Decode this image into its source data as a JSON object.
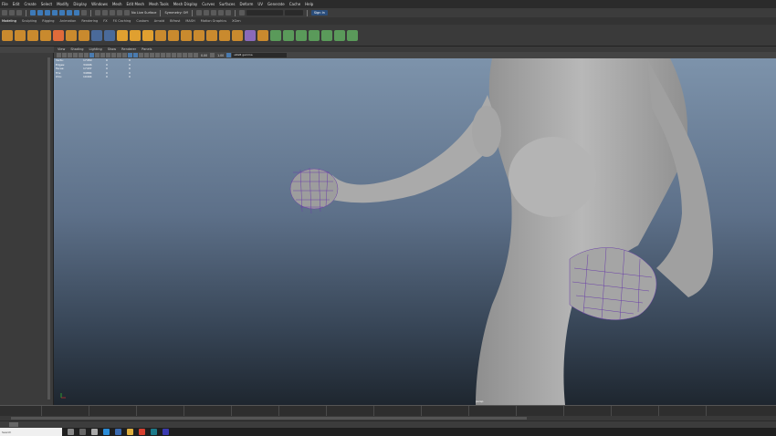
{
  "menus": [
    "File",
    "Edit",
    "Create",
    "Select",
    "Modify",
    "Display",
    "Windows",
    "Mesh",
    "Edit Mesh",
    "Mesh Tools",
    "Mesh Display",
    "Curves",
    "Surfaces",
    "Deform",
    "UV",
    "Generate",
    "Cache",
    "Help"
  ],
  "statusline": {
    "no_live_surface": "No Live Surface",
    "symmetry": "Symmetry: Off",
    "sign_in": "Sign In"
  },
  "shelf_tabs": [
    "Modeling",
    "Sculpting",
    "Rigging",
    "Animation",
    "Rendering",
    "FX",
    "FX Caching",
    "Custom",
    "Arnold",
    "Bifrost",
    "MASH",
    "Motion Graphics",
    "XGen"
  ],
  "shelf_tabs_active": "Modeling",
  "viewport_menu": [
    "View",
    "Shading",
    "Lighting",
    "Show",
    "Renderer",
    "Panels"
  ],
  "viewport_toolbar": {
    "exposure": "0.00",
    "gamma": "1.00",
    "color_space": "sRGB gamma"
  },
  "hud": [
    {
      "label": "Verts:",
      "a": "17450",
      "b": "0",
      "c": "0"
    },
    {
      "label": "Edges:",
      "a": "34906",
      "b": "0",
      "c": "0"
    },
    {
      "label": "Faces:",
      "a": "17437",
      "b": "0",
      "c": "0"
    },
    {
      "label": "Tris:",
      "a": "34884",
      "b": "0",
      "c": "0"
    },
    {
      "label": "UVs:",
      "a": "19404",
      "b": "0",
      "c": "0"
    }
  ],
  "camera_label": "persp",
  "taskbar": {
    "search_placeholder": "Search"
  },
  "colors": {
    "accent": "#3d7ab8",
    "viewport_top": "#7d93ab",
    "viewport_bottom": "#1e262f",
    "model": "#a8a8a8",
    "wireframe": "#6a3fa8"
  }
}
